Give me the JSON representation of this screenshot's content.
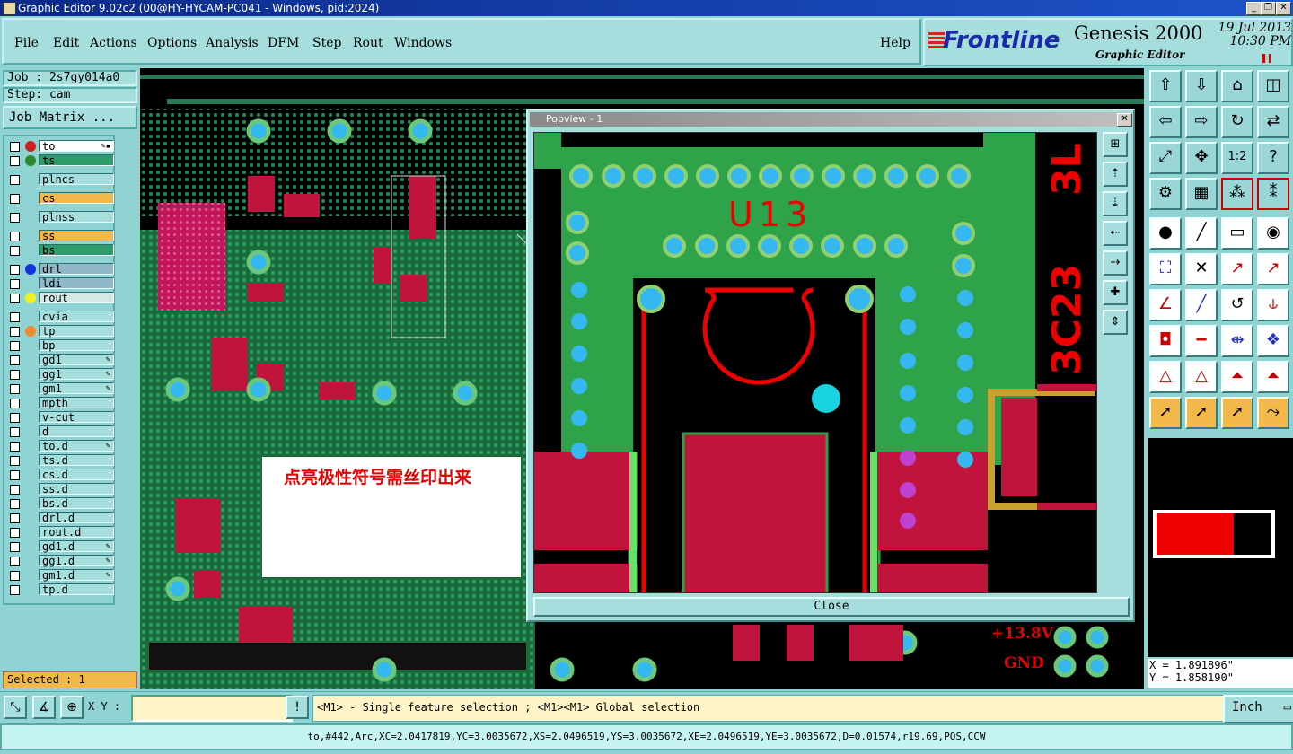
{
  "window": {
    "title": "Graphic Editor 9.02c2 (00@HY-HYCAM-PC041 - Windows, pid:2024)"
  },
  "menu": {
    "items": [
      "File",
      "Edit",
      "Actions",
      "Options",
      "Analysis",
      "DFM",
      "Step",
      "Rout",
      "Windows"
    ],
    "help": "Help"
  },
  "brand": {
    "logo": "Frontline",
    "product": "Genesis 2000",
    "subtitle": "Graphic Editor",
    "date": "19 Jul 2013",
    "time": "10:30 PM"
  },
  "job": {
    "job_label": "Job : 2s7gy014a0",
    "step_label": "Step: cam",
    "matrix_button": "Job Matrix ..."
  },
  "layers": [
    {
      "name": "to",
      "color": "#ffffff",
      "dot": "#cc2222",
      "flag": "✎▪"
    },
    {
      "name": "ts",
      "color": "#2e9c6a",
      "dot": "#2a8a2a",
      "flag": ""
    },
    {
      "name": "plncs",
      "color": "#a6dede",
      "dot": "",
      "flag": ""
    },
    {
      "name": "cs",
      "color": "#f3b84a",
      "dot": "",
      "flag": ""
    },
    {
      "name": "plnss",
      "color": "#a6dede",
      "dot": "",
      "flag": ""
    },
    {
      "name": "ss",
      "color": "#f3b84a",
      "dot": "",
      "flag": ""
    },
    {
      "name": "bs",
      "color": "#2e9c6a",
      "dot": "",
      "flag": ""
    },
    {
      "name": "drl",
      "color": "#8fb8c8",
      "dot": "#1530e0",
      "flag": ""
    },
    {
      "name": "ldi",
      "color": "#8fb8c8",
      "dot": "",
      "flag": ""
    },
    {
      "name": "rout",
      "color": "#d4e8e8",
      "dot": "#f0f020",
      "flag": ""
    },
    {
      "name": "cvia",
      "color": "#a6dede",
      "dot": "",
      "flag": ""
    },
    {
      "name": "tp",
      "color": "#a6dede",
      "dot": "#f08c30",
      "flag": ""
    },
    {
      "name": "bp",
      "color": "#a6dede",
      "dot": "",
      "flag": ""
    },
    {
      "name": "gd1",
      "color": "#a6dede",
      "dot": "",
      "flag": "✎"
    },
    {
      "name": "gg1",
      "color": "#a6dede",
      "dot": "",
      "flag": "✎"
    },
    {
      "name": "gm1",
      "color": "#a6dede",
      "dot": "",
      "flag": "✎"
    },
    {
      "name": "mpth",
      "color": "#a6dede",
      "dot": "",
      "flag": ""
    },
    {
      "name": "v-cut",
      "color": "#a6dede",
      "dot": "",
      "flag": ""
    },
    {
      "name": "d",
      "color": "#a6dede",
      "dot": "",
      "flag": ""
    },
    {
      "name": "to.d",
      "color": "#a6dede",
      "dot": "",
      "flag": "✎"
    },
    {
      "name": "ts.d",
      "color": "#a6dede",
      "dot": "",
      "flag": ""
    },
    {
      "name": "cs.d",
      "color": "#a6dede",
      "dot": "",
      "flag": ""
    },
    {
      "name": "ss.d",
      "color": "#a6dede",
      "dot": "",
      "flag": ""
    },
    {
      "name": "bs.d",
      "color": "#a6dede",
      "dot": "",
      "flag": ""
    },
    {
      "name": "drl.d",
      "color": "#a6dede",
      "dot": "",
      "flag": ""
    },
    {
      "name": "rout.d",
      "color": "#a6dede",
      "dot": "",
      "flag": ""
    },
    {
      "name": "gd1.d",
      "color": "#a6dede",
      "dot": "",
      "flag": "✎"
    },
    {
      "name": "gg1.d",
      "color": "#a6dede",
      "dot": "",
      "flag": "✎"
    },
    {
      "name": "gm1.d",
      "color": "#a6dede",
      "dot": "",
      "flag": "✎"
    },
    {
      "name": "tp.d",
      "color": "#a6dede",
      "dot": "",
      "flag": ""
    }
  ],
  "selected": "Selected : 1",
  "popup": {
    "title": "Popview - 1",
    "close": "Close",
    "labels": {
      "u13": "U13",
      "c23": "3C23",
      "l3": "3L"
    }
  },
  "annotation": "点亮极性符号需丝印出来",
  "board_labels": {
    "v": "+13.8V",
    "gnd": "GND"
  },
  "coords": {
    "x": "X = 1.891896\"",
    "y": "Y = 1.858190\""
  },
  "bottom": {
    "xy_label": "X Y :",
    "prompt": "<M1> - Single feature selection ; <M1><M1> Global selection",
    "unit": "Inch"
  },
  "status": "to,#442,Arc,XC=2.0417819,YC=3.0035672,XS=2.0496519,YS=3.0035672,XE=2.0496519,YE=3.0035672,D=0.01574,r19.69,POS,CCW"
}
